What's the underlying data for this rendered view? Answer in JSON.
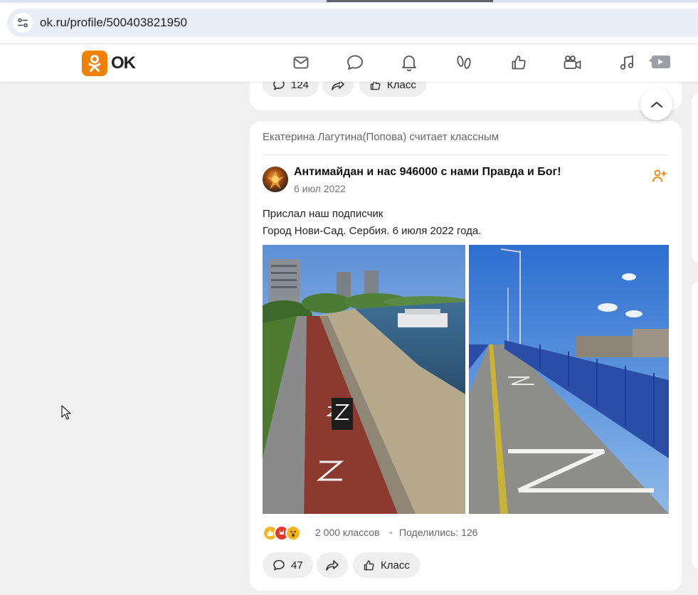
{
  "browser": {
    "url": "ok.ru/profile/500403821950"
  },
  "header": {
    "logo_text": "OK",
    "nav_icons": [
      "mail-icon",
      "chat-icon",
      "bell-icon",
      "guests-icon",
      "likes-icon",
      "video-icon",
      "music-icon",
      "video-play-icon"
    ]
  },
  "prev_post": {
    "comments_count": "124",
    "like_label": "Класс"
  },
  "post": {
    "liked_by": "Екатерина Лагутина(Попова) считает классным",
    "group_name": "Антимайдан и нас 946000 с нами Правда и Бог!",
    "date": "6 июл 2022",
    "text_line1": "Прислал наш подписчик",
    "text_line2": "Город Нови-Сад. Сербия. 6 июля 2022 года.",
    "likes": "2 000 классов",
    "shares": "Поделились: 126",
    "comments_count": "47",
    "like_label": "Класс"
  },
  "colors": {
    "brand": "#ee8208",
    "background": "#f0f0f0",
    "card": "#ffffff"
  }
}
